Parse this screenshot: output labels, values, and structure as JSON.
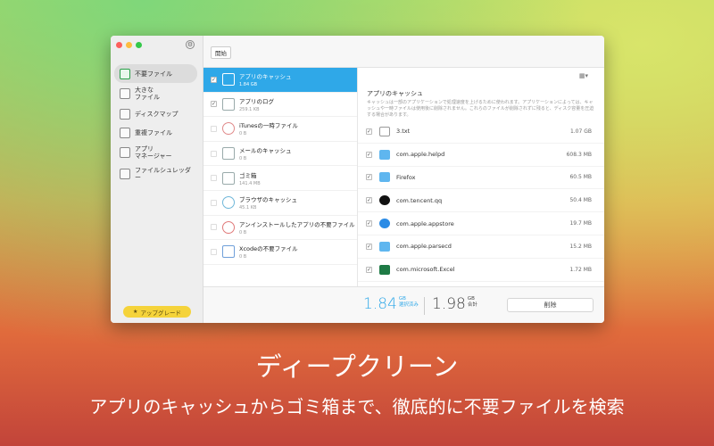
{
  "sidebar": {
    "items": [
      {
        "label": "不要ファイル",
        "active": true,
        "icon": "trash-can-icon"
      },
      {
        "label": "大きな\nファイル",
        "active": false,
        "icon": "large-file-icon"
      },
      {
        "label": "ディスクマップ",
        "active": false,
        "icon": "disk-map-icon"
      },
      {
        "label": "重複ファイル",
        "active": false,
        "icon": "duplicate-icon"
      },
      {
        "label": "アプリ\nマネージャー",
        "active": false,
        "icon": "app-manager-icon"
      },
      {
        "label": "ファイルシュレッダー",
        "active": false,
        "icon": "shredder-icon"
      }
    ],
    "upgrade_label": "アップグレード"
  },
  "toolbar": {
    "start_label": "開始"
  },
  "categories": [
    {
      "name": "アプリのキャッシュ",
      "size": "1.84 GB",
      "checked": true
    },
    {
      "name": "アプリのログ",
      "size": "259.1 KB",
      "checked": true
    },
    {
      "name": "iTunesの一時ファイル",
      "size": "0 B",
      "checked": false
    },
    {
      "name": "メールのキャッシュ",
      "size": "0 B",
      "checked": false
    },
    {
      "name": "ゴミ箱",
      "size": "141.4 MB",
      "checked": false
    },
    {
      "name": "ブラウザのキャッシュ",
      "size": "45.1 KB",
      "checked": false
    },
    {
      "name": "アンインストールしたアプリの不要ファイル",
      "size": "0 B",
      "checked": false
    },
    {
      "name": "Xcodeの不要ファイル",
      "size": "0 B",
      "checked": false
    }
  ],
  "detail": {
    "title": "アプリのキャッシュ",
    "description": "キャッシュは一部のアプリケーションで処理速度を上げるために使われます。アプリケーションによっては、キャッシュや一時ファイルは使用後に削除されません。これらのファイルが削除されずに残ると、ディスク容量を圧迫する場合があります。",
    "files": [
      {
        "name": "3.txt",
        "size": "1.07 GB",
        "icon": "document-icon"
      },
      {
        "name": "com.apple.helpd",
        "size": "608.3 MB",
        "icon": "folder-icon"
      },
      {
        "name": "Firefox",
        "size": "60.5 MB",
        "icon": "folder-icon"
      },
      {
        "name": "com.tencent.qq",
        "size": "50.4 MB",
        "icon": "qq-penguin-icon"
      },
      {
        "name": "com.apple.appstore",
        "size": "19.7 MB",
        "icon": "app-store-icon"
      },
      {
        "name": "com.apple.parsecd",
        "size": "15.2 MB",
        "icon": "folder-icon"
      },
      {
        "name": "com.microsoft.Excel",
        "size": "1.72 MB",
        "icon": "excel-icon"
      }
    ]
  },
  "summary": {
    "selected_value": "1.84",
    "selected_unit": "GB",
    "selected_label": "選択済み",
    "total_value": "1.98",
    "total_unit": "GB",
    "total_label": "合計",
    "delete_label": "削除"
  },
  "promo": {
    "headline": "ディープクリーン",
    "subline": "アプリのキャッシュからゴミ箱まで、徹底的に不要ファイルを検索"
  },
  "colors": {
    "accent_blue": "#2fa8e8",
    "upgrade_yellow": "#f5d33a",
    "selected_value": "#2fa8e8",
    "close": "#fc605c",
    "minimize": "#fdbc40",
    "maximize": "#34c84a"
  }
}
